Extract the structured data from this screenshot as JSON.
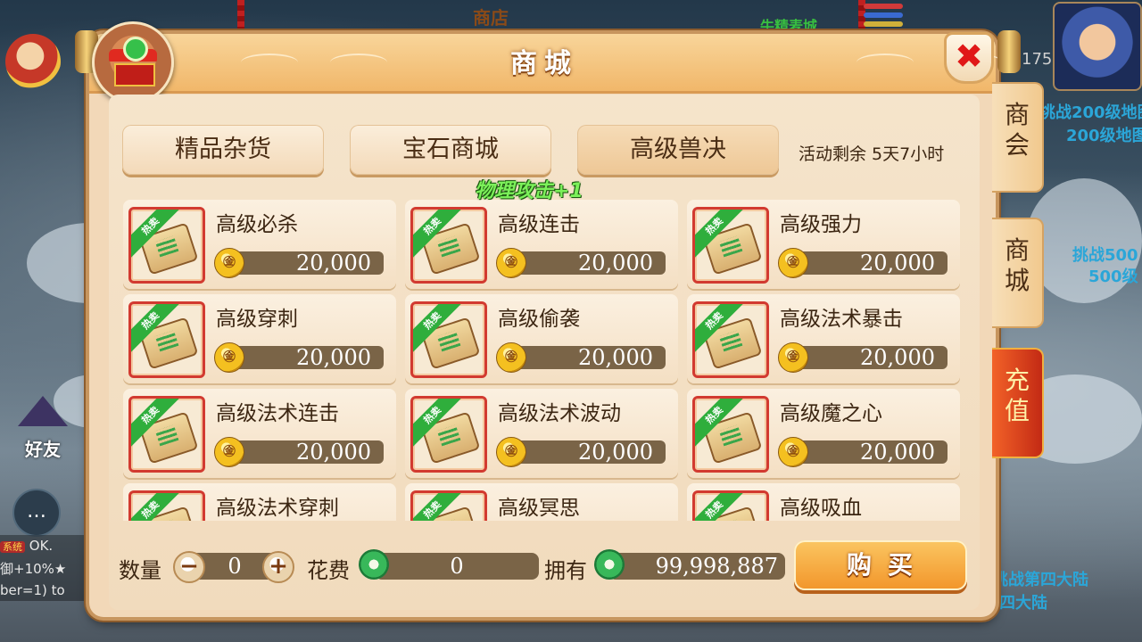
{
  "background": {
    "shop_sign": "商店",
    "green_text": "牛精麦城",
    "map_text_1": "挑战200级地图",
    "map_text_2": "200级地图",
    "map_text_3": "挑战500",
    "map_text_4": "500级",
    "map_text_5": "挑战第四大陆",
    "map_text_6": "第四大陆",
    "hero_level": "175",
    "friend_label": "好友",
    "chat_icon": "chat-bubble-icon",
    "chat_lines": [
      "OK.",
      "御+10%★",
      "ber=1) to"
    ],
    "chat_sys_tag": "系统"
  },
  "panel": {
    "title": "商城",
    "close_label": "✖",
    "tabs": [
      {
        "label": "精品杂货"
      },
      {
        "label": "宝石商城"
      },
      {
        "label": "高级兽决"
      }
    ],
    "countdown": "活动剩余 5天7小时",
    "float_buff": "物理攻击+1"
  },
  "items": [
    {
      "name": "高级必杀",
      "price": "20,000",
      "badge": "热卖"
    },
    {
      "name": "高级连击",
      "price": "20,000",
      "badge": "热卖"
    },
    {
      "name": "高级强力",
      "price": "20,000",
      "badge": "热卖"
    },
    {
      "name": "高级穿刺",
      "price": "20,000",
      "badge": "热卖"
    },
    {
      "name": "高级偷袭",
      "price": "20,000",
      "badge": "热卖"
    },
    {
      "name": "高级法术暴击",
      "price": "20,000",
      "badge": "热卖"
    },
    {
      "name": "高级法术连击",
      "price": "20,000",
      "badge": "热卖"
    },
    {
      "name": "高级法术波动",
      "price": "20,000",
      "badge": "热卖"
    },
    {
      "name": "高级魔之心",
      "price": "20,000",
      "badge": "热卖"
    },
    {
      "name": "高级法术穿刺",
      "price": "",
      "badge": "热卖"
    },
    {
      "name": "高级冥思",
      "price": "",
      "badge": "热卖"
    },
    {
      "name": "高级吸血",
      "price": "",
      "badge": "热卖"
    }
  ],
  "coin_glyph": "㊎",
  "bottom": {
    "qty_label": "数量",
    "qty_value": "0",
    "minus": "−",
    "plus": "+",
    "cost_label": "花费",
    "cost_value": "0",
    "own_label": "拥有",
    "own_value": "99,998,887",
    "buy_label": "购买"
  },
  "side_tabs": [
    {
      "label": "商会"
    },
    {
      "label": "商城"
    },
    {
      "label": "充值"
    }
  ]
}
